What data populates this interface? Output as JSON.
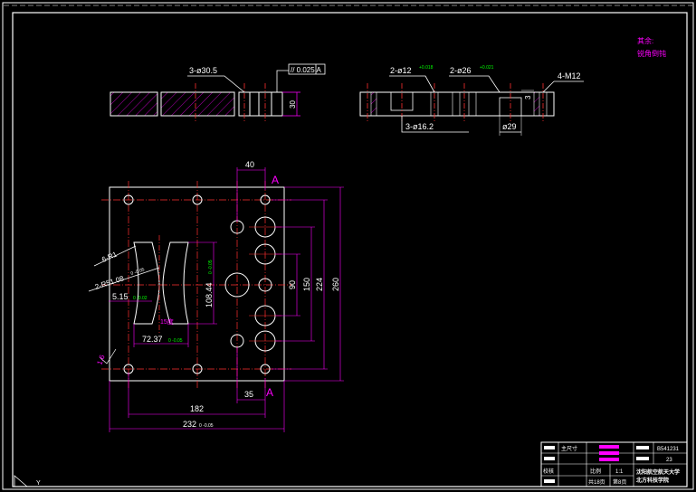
{
  "colors": {
    "background": "#000000",
    "outline": "#ffffff",
    "dimension": "#ff00ff",
    "centerline": "#ff3030",
    "hatch": "#ff00ff",
    "highlight": "#00ff00",
    "text": "#ffffff"
  },
  "notes": {
    "line1": "其余:",
    "line2": "锐角倒钝"
  },
  "top_view_left": {
    "hole_callout": "3-ø30.5",
    "tolerance_box": "// 0.025 A",
    "thickness": "30"
  },
  "top_view_right": {
    "hole_a_callout": "2-ø12",
    "hole_a_tol": "+0.018",
    "hole_b_callout": "2-ø26",
    "hole_b_tol": "+0.021",
    "thread": "4-M12",
    "counterbore": "3-ø16.2",
    "dia": "ø29",
    "depth": "3"
  },
  "plan_view": {
    "section_a_top": "A",
    "section_a_bottom": "A",
    "dim_40": "40",
    "dim_35": "35",
    "dim_182": "182",
    "dim_232": "232",
    "dim_232_tol": "0\n-0.05",
    "dim_260": "260",
    "dim_224": "224",
    "dim_150": "150",
    "dim_90": "90",
    "radius_6": "6-R1",
    "radius_2": "2-R51.08",
    "radius_2_tol": "0\n-0.05",
    "dim_515": "5.15",
    "dim_515_tol": "0\n-0.02",
    "dim_10844": "108.44",
    "dim_10844_tol": "0\n-0.05",
    "dim_7237": "72.37",
    "dim_7237_tol": "0\n-0.05",
    "deg": "15度",
    "roughness": "1.6"
  },
  "title_block": {
    "row1_left": "主尺寸",
    "row1_right": "B541231",
    "row2_right": "23",
    "row3_left": "校核",
    "scale_label": "比例",
    "scale_value": "1:1",
    "sheet_total": "共18页",
    "sheet_num": "第8页",
    "org_line1": "沈阳航空航天大学",
    "org_line2": "北方科技学院"
  }
}
